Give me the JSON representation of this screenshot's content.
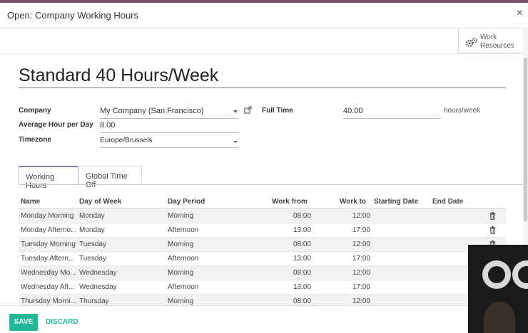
{
  "modal": {
    "title": "Open: Company Working Hours",
    "close_glyph": "×"
  },
  "smart_button": {
    "label_line1": "Work",
    "label_line2": "Resources",
    "icon": "gears-icon"
  },
  "record": {
    "name": "Standard 40 Hours/Week"
  },
  "fields": {
    "company_label": "Company",
    "company_value": "My Company (San Francisco)",
    "avg_label": "Average Hour per Day",
    "avg_value": "8.00",
    "tz_label": "Timezone",
    "tz_value": "Europe/Brussels",
    "fulltime_label": "Full Time",
    "fulltime_value": "40.00",
    "fulltime_unit": "hours/week"
  },
  "tabs": [
    "Working Hours",
    "Global Time Off"
  ],
  "table": {
    "headers": [
      "Name",
      "Day of Week",
      "Day Period",
      "Work from",
      "Work to",
      "Starting Date",
      "End Date"
    ],
    "rows": [
      [
        "Monday Morning",
        "Monday",
        "Morning",
        "08:00",
        "12:00"
      ],
      [
        "Monday Afterno...",
        "Monday",
        "Afternoon",
        "13:00",
        "17:00"
      ],
      [
        "Tuesday Morning",
        "Tuesday",
        "Morning",
        "08:00",
        "12:00"
      ],
      [
        "Tuesday Aftern...",
        "Tuesday",
        "Afternoon",
        "13:00",
        "17:00"
      ],
      [
        "Wednesday Mo...",
        "Wednesday",
        "Morning",
        "08:00",
        "12:00"
      ],
      [
        "Wednesday Aft...",
        "Wednesday",
        "Afternoon",
        "13:00",
        "17:00"
      ],
      [
        "Thursday Morni...",
        "Thursday",
        "Morning",
        "08:00",
        "12:00"
      ]
    ]
  },
  "footer": {
    "save_label": "SAVE",
    "discard_label": "DISCARD"
  },
  "colors": {
    "accent": "#21b799",
    "tab_accent": "#7c7bad",
    "navbar": "#7a4f6f"
  }
}
